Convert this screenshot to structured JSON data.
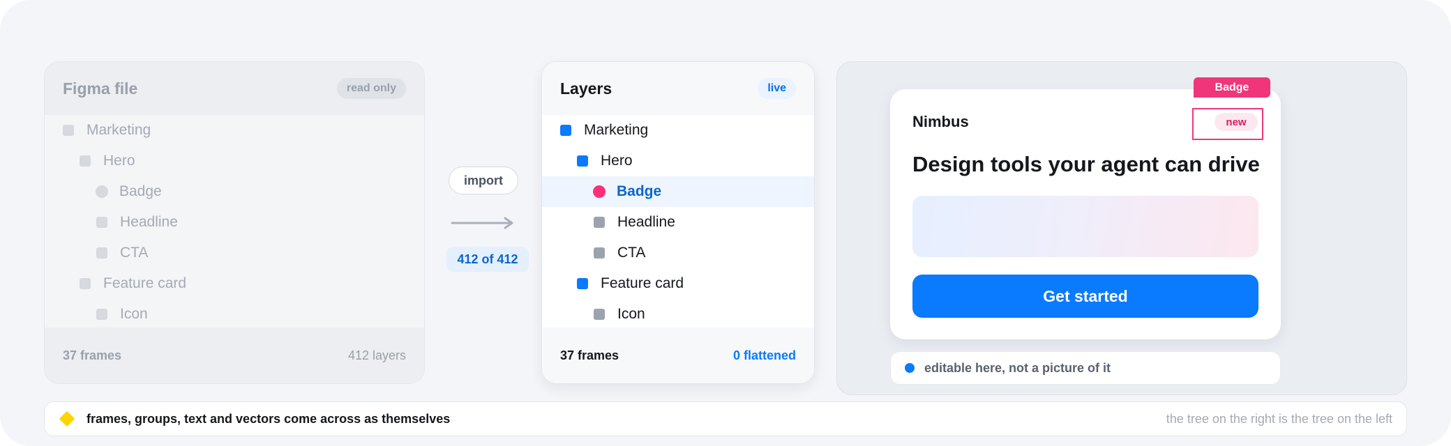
{
  "source_panel": {
    "title": "Figma file",
    "badge": "read only",
    "layers": [
      {
        "label": "Marketing",
        "icon": "frame-icon"
      },
      {
        "label": "Hero",
        "icon": "frame-icon"
      },
      {
        "label": "Badge",
        "icon": "ellipse-icon"
      },
      {
        "label": "Headline",
        "icon": "text-icon"
      },
      {
        "label": "CTA",
        "icon": "text-icon"
      },
      {
        "label": "Feature card",
        "icon": "frame-icon"
      },
      {
        "label": "Icon",
        "icon": "vector-icon"
      }
    ],
    "footer_left": "37 frames",
    "footer_right": "412 layers"
  },
  "connector": {
    "action_label": "import",
    "count_label": "412 of 412",
    "arrow_icon": "arrow-right-icon"
  },
  "layers_panel": {
    "title": "Layers",
    "badge": "live",
    "layers": [
      {
        "label": "Marketing",
        "icon": "frame-icon",
        "color": "#0a7aff"
      },
      {
        "label": "Hero",
        "icon": "frame-icon",
        "color": "#0a7aff"
      },
      {
        "label": "Badge",
        "icon": "ellipse-icon",
        "color": "#ff2e78",
        "selected": true
      },
      {
        "label": "Headline",
        "icon": "text-icon",
        "color": "#9ca3ae"
      },
      {
        "label": "CTA",
        "icon": "text-icon",
        "color": "#9ca3ae"
      },
      {
        "label": "Feature card",
        "icon": "frame-icon",
        "color": "#0a7aff"
      },
      {
        "label": "Icon",
        "icon": "vector-icon",
        "color": "#9ca3ae"
      }
    ],
    "footer_left": "37 frames",
    "footer_right": "0 flattened"
  },
  "preview": {
    "brand": "Nimbus",
    "badge_text": "new",
    "headline": "Design tools your agent can drive",
    "cta_label": "Get started",
    "selection_tag": "Badge",
    "note": "editable here, not a picture of it"
  },
  "bottom_bar": {
    "left_text": "frames, groups, text and vectors come across as themselves",
    "right_text": "the tree on the right is the tree on the left"
  },
  "colors": {
    "accent": "#0a7aff",
    "selection": "#f0357a",
    "badge_dot": "#ff2e78",
    "marker": "#ffd400"
  }
}
